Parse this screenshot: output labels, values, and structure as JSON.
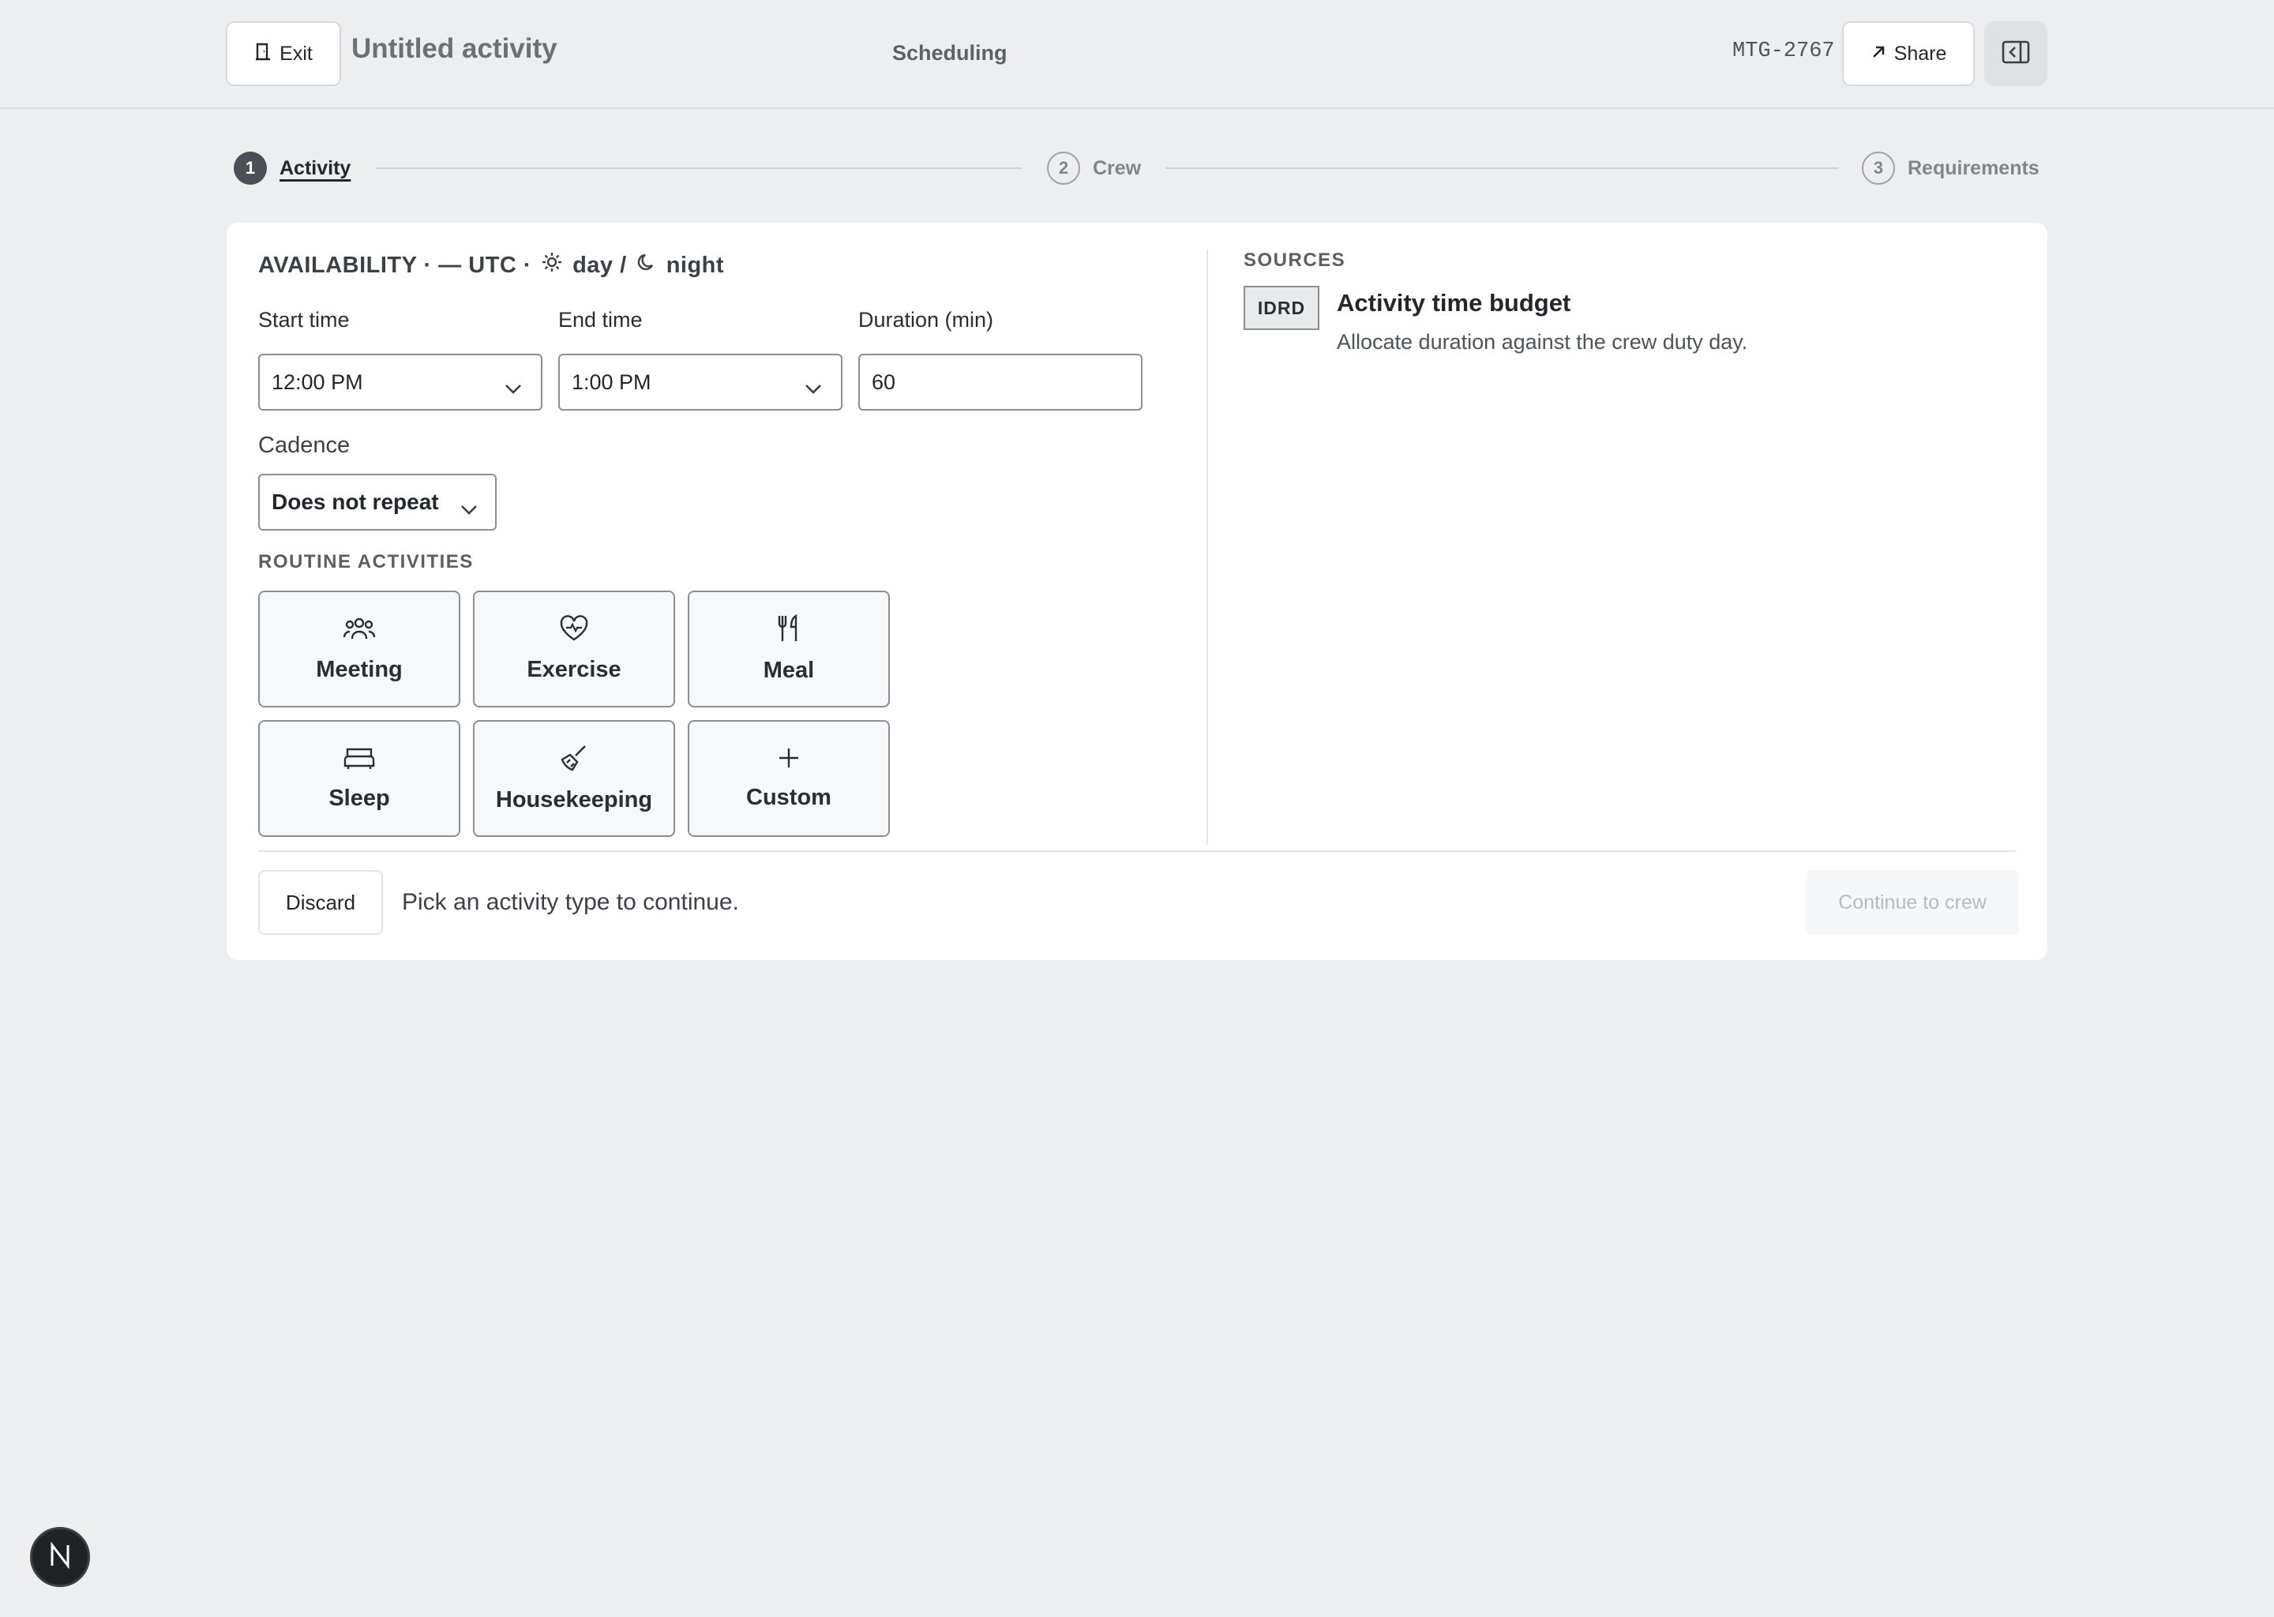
{
  "header": {
    "exit_label": "Exit",
    "title": "Untitled activity",
    "section": "Scheduling",
    "code": "MTG-2767",
    "share_label": "Share"
  },
  "steps": [
    {
      "num": "1",
      "label": "Activity"
    },
    {
      "num": "2",
      "label": "Crew"
    },
    {
      "num": "3",
      "label": "Requirements"
    }
  ],
  "availability": {
    "heading_prefix": "AVAILABILITY · — UTC ·",
    "day": "day /",
    "night": "night",
    "start_label": "Start time",
    "start_value": "12:00 PM",
    "end_label": "End time",
    "end_value": "1:00 PM",
    "duration_label": "Duration (min)",
    "duration_value": "60",
    "cadence_label": "Cadence",
    "cadence_value": "Does not repeat"
  },
  "routine": {
    "heading": "ROUTINE ACTIVITIES",
    "tiles": [
      {
        "label": "Meeting",
        "icon": "people-icon"
      },
      {
        "label": "Exercise",
        "icon": "heart-pulse-icon"
      },
      {
        "label": "Meal",
        "icon": "utensils-icon"
      },
      {
        "label": "Sleep",
        "icon": "bed-icon"
      },
      {
        "label": "Housekeeping",
        "icon": "broom-icon"
      },
      {
        "label": "Custom",
        "icon": "plus-icon"
      }
    ]
  },
  "sources": {
    "heading": "SOURCES",
    "badge": "IDRD",
    "title": "Activity time budget",
    "description": "Allocate duration against the crew duty day."
  },
  "footer": {
    "discard_label": "Discard",
    "hint": "Pick an activity type to continue.",
    "continue_label": "Continue to crew"
  },
  "fab_letter": "N"
}
